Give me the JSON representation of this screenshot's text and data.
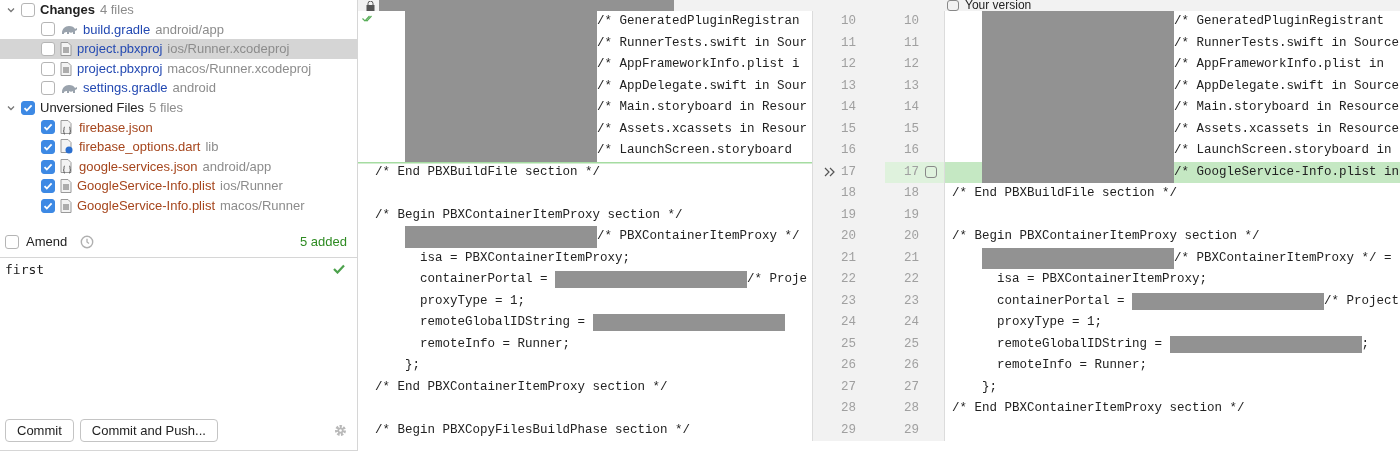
{
  "changelist": {
    "groups": [
      {
        "label": "Changes",
        "count": "4 files",
        "active": true,
        "color": "#2349b2",
        "expanded": true,
        "checked": false,
        "files": [
          {
            "name": "build.gradle",
            "path": "android/app",
            "kind": "gradle",
            "checked": false,
            "selected": false
          },
          {
            "name": "project.pbxproj",
            "path": "ios/Runner.xcodeproj",
            "kind": "text",
            "checked": false,
            "selected": true
          },
          {
            "name": "project.pbxproj",
            "path": "macos/Runner.xcodeproj",
            "kind": "text",
            "checked": false,
            "selected": false
          },
          {
            "name": "settings.gradle",
            "path": "android",
            "kind": "gradle",
            "checked": false,
            "selected": false
          }
        ]
      },
      {
        "label": "Unversioned Files",
        "count": "5 files",
        "active": false,
        "color": "#a5451c",
        "expanded": true,
        "checked": true,
        "files": [
          {
            "name": "firebase.json",
            "kind": "json",
            "checked": true,
            "selected": false
          },
          {
            "name": "firebase_options.dart",
            "path": "lib",
            "kind": "dart",
            "checked": true,
            "selected": false
          },
          {
            "name": "google-services.json",
            "path": "android/app",
            "kind": "json",
            "checked": true,
            "selected": false
          },
          {
            "name": "GoogleService-Info.plist",
            "path": "ios/Runner",
            "kind": "text",
            "checked": true,
            "selected": false
          },
          {
            "name": "GoogleService-Info.plist",
            "path": "macos/Runner",
            "kind": "text",
            "checked": true,
            "selected": false
          }
        ]
      }
    ]
  },
  "amend": {
    "label": "Amend",
    "checked": false
  },
  "summary": "5 added",
  "commit_message": "first",
  "buttons": [
    "Commit",
    "Commit and Push..."
  ],
  "diff": {
    "right_header": {
      "label": "Your version",
      "checked": false
    },
    "rows": [
      {
        "left_number": "10",
        "right_number": "10",
        "left": {
          "masked": true,
          "after": "/* GeneratedPluginRegistran"
        },
        "right": {
          "masked": true,
          "after": "/* GeneratedPluginRegistrant"
        }
      },
      {
        "left_number": "11",
        "right_number": "11",
        "left": {
          "masked": true,
          "after": "/* RunnerTests.swift in Sour"
        },
        "right": {
          "masked": true,
          "after": "/* RunnerTests.swift in Source"
        }
      },
      {
        "left_number": "12",
        "right_number": "12",
        "left": {
          "masked": true,
          "after": "/* AppFrameworkInfo.plist i"
        },
        "right": {
          "masked": true,
          "after": "/* AppFrameworkInfo.plist in"
        }
      },
      {
        "left_number": "13",
        "right_number": "13",
        "left": {
          "masked": true,
          "after": "/* AppDelegate.swift in Sour"
        },
        "right": {
          "masked": true,
          "after": "/* AppDelegate.swift in Source"
        }
      },
      {
        "left_number": "14",
        "right_number": "14",
        "left": {
          "masked": true,
          "after": "/* Main.storyboard in Resour"
        },
        "right": {
          "masked": true,
          "after": "/* Main.storyboard in Resource"
        }
      },
      {
        "left_number": "15",
        "right_number": "15",
        "left": {
          "masked": true,
          "after": "/* Assets.xcassets in Resour"
        },
        "right": {
          "masked": true,
          "after": "/* Assets.xcassets in Resource"
        }
      },
      {
        "left_number": "16",
        "right_number": "16",
        "left": {
          "masked": true,
          "after": "/* LaunchScreen.storyboard"
        },
        "right": {
          "masked": true,
          "after": "/* LaunchScreen.storyboard in"
        }
      },
      {
        "left_number": "17",
        "right_number": "17",
        "added": true,
        "checked": false,
        "left": {
          "text": "/* End PBXBuildFile section */"
        },
        "right": {
          "masked": true,
          "after": "/* GoogleService-Info.plist in"
        }
      },
      {
        "left_number": "18",
        "right_number": "18",
        "left": null,
        "right": {
          "text": "/* End PBXBuildFile section */"
        }
      },
      {
        "left_number": "19",
        "right_number": "19",
        "left": {
          "text": "/* Begin PBXContainerItemProxy section */"
        },
        "right": null
      },
      {
        "left_number": "20",
        "right_number": "20",
        "left": {
          "masked": true,
          "after": "/* PBXContainerItemProxy */"
        },
        "right": {
          "text": "/* Begin PBXContainerItemProxy section */"
        }
      },
      {
        "left_number": "21",
        "right_number": "21",
        "left": {
          "text": "      isa = PBXContainerItemProxy;"
        },
        "right": {
          "masked": true,
          "after": "/* PBXContainerItemProxy */ ="
        }
      },
      {
        "left_number": "22",
        "right_number": "22",
        "left": {
          "text": "      containerPortal = ",
          "masked": true,
          "after": "/* Proje"
        },
        "right": {
          "text": "      isa = PBXContainerItemProxy;"
        }
      },
      {
        "left_number": "23",
        "right_number": "23",
        "left": {
          "text": "      proxyType = 1;"
        },
        "right": {
          "text": "      containerPortal = ",
          "masked": true,
          "after": "/* Project"
        }
      },
      {
        "left_number": "24",
        "right_number": "24",
        "left": {
          "text": "      remoteGlobalIDString = ",
          "masked": true
        },
        "right": {
          "text": "      proxyType = 1;"
        }
      },
      {
        "left_number": "25",
        "right_number": "25",
        "left": {
          "text": "      remoteInfo = Runner;"
        },
        "right": {
          "text": "      remoteGlobalIDString = ",
          "masked": true,
          "after": ";"
        }
      },
      {
        "left_number": "26",
        "right_number": "26",
        "left": {
          "text": "    };"
        },
        "right": {
          "text": "      remoteInfo = Runner;"
        }
      },
      {
        "left_number": "27",
        "right_number": "27",
        "left": {
          "text": "/* End PBXContainerItemProxy section */"
        },
        "right": {
          "text": "    };"
        }
      },
      {
        "left_number": "28",
        "right_number": "28",
        "left": null,
        "right": {
          "text": "/* End PBXContainerItemProxy section */"
        }
      },
      {
        "left_number": "29",
        "right_number": "29",
        "left": {
          "text": "/* Begin PBXCopyFilesBuildPhase section */"
        },
        "right": null
      }
    ]
  }
}
